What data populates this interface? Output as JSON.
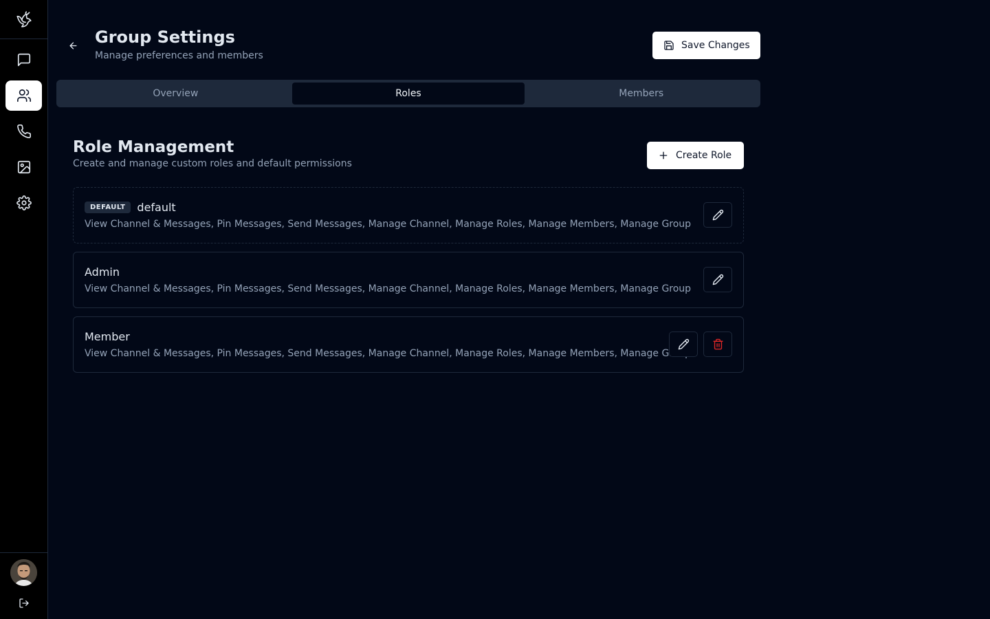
{
  "sidebar": {
    "logo": "bird-logo",
    "items": [
      {
        "icon": "message-square-icon",
        "active": false
      },
      {
        "icon": "users-icon",
        "active": true
      },
      {
        "icon": "phone-icon",
        "active": false
      },
      {
        "icon": "image-icon",
        "active": false
      },
      {
        "icon": "settings-icon",
        "active": false
      }
    ],
    "avatar": "user-avatar",
    "logout_icon": "log-out-icon"
  },
  "header": {
    "title": "Group Settings",
    "subtitle": "Manage preferences and members",
    "save_label": "Save Changes"
  },
  "tabs": [
    {
      "label": "Overview",
      "active": false
    },
    {
      "label": "Roles",
      "active": true
    },
    {
      "label": "Members",
      "active": false
    }
  ],
  "roles_section": {
    "title": "Role Management",
    "subtitle": "Create and manage custom roles and default permissions",
    "create_label": "Create Role",
    "roles": [
      {
        "badge": "DEFAULT",
        "name": "default",
        "permissions": "View Channel & Messages, Pin Messages, Send Messages, Manage Channel, Manage Roles, Manage Members, Manage Group",
        "deletable": false
      },
      {
        "badge": "",
        "name": "Admin",
        "permissions": "View Channel & Messages, Pin Messages, Send Messages, Manage Channel, Manage Roles, Manage Members, Manage Group",
        "deletable": false
      },
      {
        "badge": "",
        "name": "Member",
        "permissions": "View Channel & Messages, Pin Messages, Send Messages, Manage Channel, Manage Roles, Manage Members, Manage Group",
        "deletable": true
      }
    ]
  },
  "colors": {
    "background": "#020817",
    "sidebar": "#000000",
    "accent_delete": "#dc2626"
  }
}
